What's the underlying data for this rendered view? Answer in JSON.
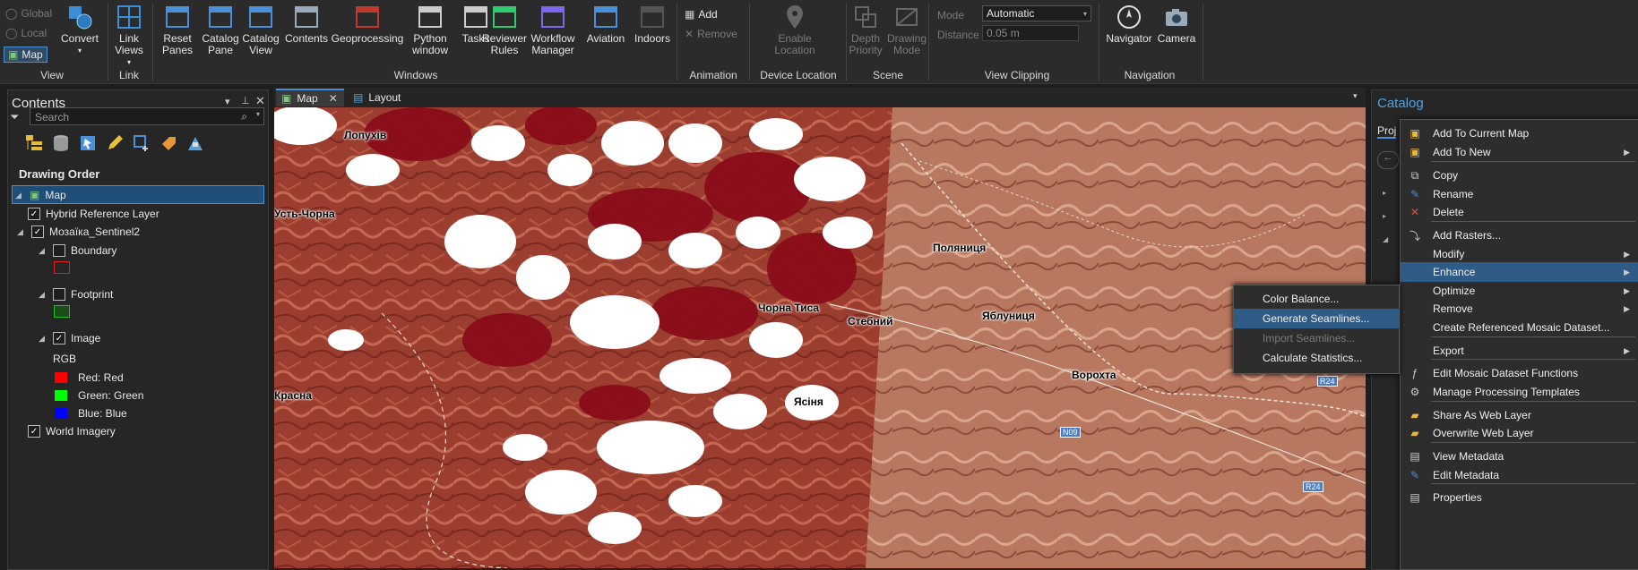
{
  "ribbon": {
    "view_group": {
      "label": "View",
      "global": "Global",
      "local": "Local",
      "map": "Map",
      "convert": "Convert"
    },
    "link_group": {
      "label": "Link",
      "link_views": "Link Views"
    },
    "windows_group": {
      "label": "Windows",
      "items": [
        "Reset Panes",
        "Catalog Pane",
        "Catalog View",
        "Contents",
        "Geoprocessing",
        "Python window",
        "Tasks",
        "Reviewer Rules",
        "Workflow Manager",
        "Aviation",
        "Indoors"
      ]
    },
    "animation_group": {
      "label": "Animation",
      "add": "Add",
      "remove": "Remove"
    },
    "device_group": {
      "label": "Device Location",
      "enable_location": "Enable Location"
    },
    "scene_group": {
      "label": "Scene",
      "depth_priority": "Depth Priority",
      "drawing_mode": "Drawing Mode"
    },
    "clipping_group": {
      "label": "View Clipping",
      "mode_label": "Mode",
      "mode_value": "Automatic",
      "distance_label": "Distance",
      "distance_value": "0.05  m"
    },
    "navigation_group": {
      "label": "Navigation",
      "navigator": "Navigator",
      "camera": "Camera"
    }
  },
  "contents": {
    "title": "Contents",
    "search_placeholder": "Search",
    "drawing_order": "Drawing Order",
    "map_node": "Map",
    "layers": {
      "hybrid": "Hybrid Reference Layer",
      "mosaic": "Мозаїка_Sentinel2",
      "boundary": "Boundary",
      "footprint": "Footprint",
      "image": "Image",
      "rgb": "RGB",
      "red": "Red:   Red",
      "green": "Green:  Green",
      "blue": "Blue:  Blue",
      "world": "World Imagery"
    }
  },
  "tabs": {
    "map": "Map",
    "layout": "Layout"
  },
  "map": {
    "places": [
      "Лопухів",
      "Усть-Чорна",
      "Красна",
      "Поляниця",
      "Чорна Тиса",
      "Стебний",
      "Яблуниця",
      "Ворохта",
      "Ясіня"
    ],
    "shields": [
      "R24",
      "N09",
      "R24"
    ]
  },
  "catalog": {
    "title": "Catalog",
    "tab_project": "Proj"
  },
  "context_menu": {
    "items": [
      "Add To Current Map",
      "Add To New",
      "Copy",
      "Rename",
      "Delete",
      "Add Rasters...",
      "Modify",
      "Enhance",
      "Optimize",
      "Remove",
      "Create Referenced Mosaic Dataset...",
      "Export",
      "Edit Mosaic Dataset Functions",
      "Manage Processing Templates",
      "Share As Web Layer",
      "Overwrite Web Layer",
      "View Metadata",
      "Edit Metadata",
      "Properties"
    ]
  },
  "submenu": {
    "items": [
      "Color Balance...",
      "Generate Seamlines...",
      "Import Seamlines...",
      "Calculate Statistics..."
    ]
  },
  "colors": {
    "accent": "#2f5b87",
    "ribbon": "#2b2b2b",
    "pane": "#262626",
    "selection": "#1f4e79"
  }
}
